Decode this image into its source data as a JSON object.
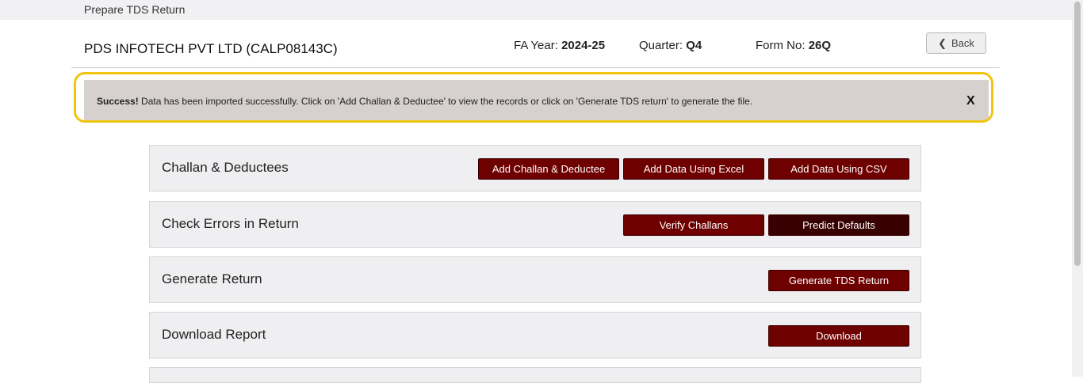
{
  "topbar": {
    "title": "Prepare TDS Return"
  },
  "header": {
    "company": "PDS INFOTECH PVT LTD (CALP08143C)",
    "fa_year_label": "FA Year: ",
    "fa_year_value": "2024-25",
    "quarter_label": "Quarter: ",
    "quarter_value": "Q4",
    "form_label": "Form No: ",
    "form_value": "26Q",
    "back_label": "Back"
  },
  "alert": {
    "strong": "Success!",
    "text": " Data has been imported successfully. Click on 'Add Challan & Deductee' to view the records or click on 'Generate TDS return' to generate the file.",
    "close": "X",
    "highlight_color": "#f1c40f"
  },
  "panels": [
    {
      "title": "Challan & Deductees",
      "buttons": [
        "Add Challan & Deductee",
        "Add Data Using Excel",
        "Add Data Using CSV"
      ]
    },
    {
      "title": "Check Errors in Return",
      "buttons": [
        "Verify Challans",
        "Predict Defaults"
      ]
    },
    {
      "title": "Generate Return",
      "buttons": [
        "Generate TDS Return"
      ]
    },
    {
      "title": "Download Report",
      "buttons": [
        "Download"
      ]
    }
  ],
  "colors": {
    "button": "#6e0000",
    "button_dark": "#380000",
    "panel": "#efeff1"
  }
}
